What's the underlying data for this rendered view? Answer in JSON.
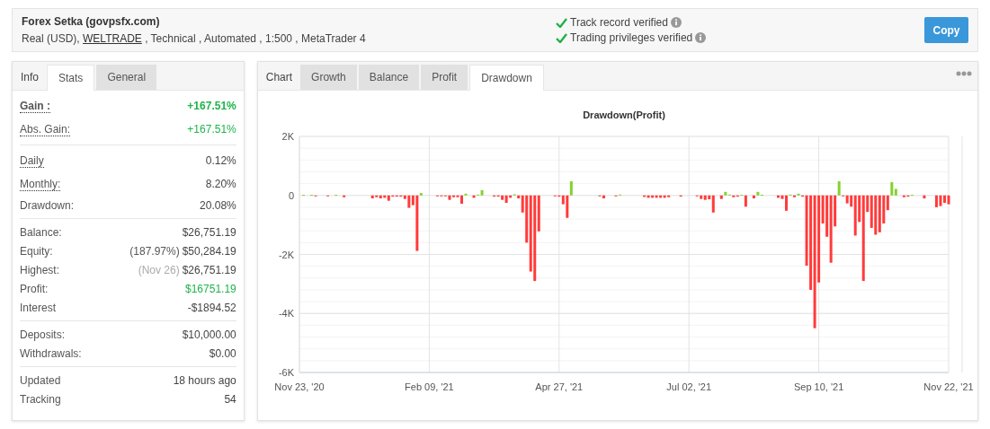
{
  "header": {
    "title": "Forex Setka (govpsfx.com)",
    "details_prefix": "Real (USD), ",
    "broker_link": "WELTRADE",
    "details_suffix": " , Technical , Automated , 1:500 , MetaTrader 4",
    "verifications": [
      {
        "label": "Track record verified",
        "verified": true
      },
      {
        "label": "Trading privileges verified",
        "verified": true
      }
    ],
    "copy_button": "Copy"
  },
  "stats_panel": {
    "title": "Info",
    "tabs": [
      {
        "label": "Stats",
        "selected": true
      },
      {
        "label": "General",
        "selected": false
      }
    ],
    "groups": [
      [
        {
          "label": "Gain :",
          "value": "+167.51%",
          "tooltip": true,
          "bold": true,
          "positive": true
        },
        {
          "label": "Abs. Gain:",
          "value": "+167.51%",
          "tooltip": true,
          "bold": false,
          "positive": true
        }
      ],
      [
        {
          "label": "Daily",
          "value": "0.12%",
          "tooltip": true,
          "bold": false,
          "positive": false
        },
        {
          "label": "Monthly:",
          "value": "8.20%",
          "tooltip": true,
          "bold": false,
          "positive": false
        },
        {
          "label": "Drawdown:",
          "value": "20.08%",
          "tooltip": false,
          "bold": false,
          "positive": false
        }
      ],
      [
        {
          "label": "Balance:",
          "value": "$26,751.19",
          "tooltip": false,
          "bold": false,
          "positive": false
        },
        {
          "label": "Equity:",
          "note": "(187.97%)",
          "note_muted": false,
          "value": "$50,284.19",
          "tooltip": false,
          "bold": false,
          "positive": false
        },
        {
          "label": "Highest:",
          "note": "(Nov 26)",
          "note_muted": true,
          "value": "$26,751.19",
          "tooltip": false,
          "bold": false,
          "positive": false
        },
        {
          "label": "Profit:",
          "value": "$16751.19",
          "tooltip": false,
          "bold": false,
          "positive": true
        },
        {
          "label": "Interest",
          "value": "-$1894.52",
          "tooltip": false,
          "bold": false,
          "positive": false
        }
      ],
      [
        {
          "label": "Deposits:",
          "value": "$10,000.00",
          "tooltip": false,
          "bold": false,
          "positive": false
        },
        {
          "label": "Withdrawals:",
          "value": "$0.00",
          "tooltip": false,
          "bold": false,
          "positive": false
        }
      ],
      [
        {
          "label": "Updated",
          "value": "18 hours ago",
          "tooltip": false,
          "bold": false,
          "positive": false
        },
        {
          "label": "Tracking",
          "value": "54",
          "tooltip": false,
          "bold": false,
          "positive": false
        }
      ]
    ]
  },
  "chart_panel": {
    "title": "Chart",
    "tabs": [
      {
        "label": "Growth",
        "selected": false
      },
      {
        "label": "Balance",
        "selected": false
      },
      {
        "label": "Profit",
        "selected": false
      },
      {
        "label": "Drawdown",
        "selected": true
      }
    ],
    "chart_data": {
      "type": "bar",
      "title": "Drawdown(Profit)",
      "grid": true,
      "ylim": [
        -6000,
        2000
      ],
      "categories": [
        "Nov 23, '20",
        null,
        null,
        null,
        null,
        null,
        null,
        null,
        null,
        null,
        null,
        null,
        null,
        null,
        null,
        null,
        null,
        null,
        null,
        null,
        null,
        null,
        null,
        null,
        null,
        null,
        null,
        null,
        null,
        null,
        null,
        null,
        "Feb 09, '21",
        null,
        null,
        null,
        null,
        null,
        null,
        null,
        null,
        null,
        null,
        null,
        null,
        null,
        null,
        null,
        null,
        null,
        null,
        null,
        null,
        null,
        null,
        null,
        null,
        null,
        null,
        null,
        null,
        null,
        null,
        null,
        "Apr 27, '21",
        null,
        null,
        null,
        null,
        null,
        null,
        null,
        null,
        null,
        null,
        null,
        null,
        null,
        null,
        null,
        null,
        null,
        null,
        null,
        null,
        null,
        null,
        null,
        null,
        null,
        null,
        null,
        null,
        null,
        null,
        null,
        "Jul 02, '21",
        null,
        null,
        null,
        null,
        null,
        null,
        null,
        null,
        null,
        null,
        null,
        null,
        null,
        null,
        null,
        null,
        null,
        null,
        null,
        null,
        null,
        null,
        null,
        null,
        null,
        null,
        null,
        null,
        null,
        null,
        null,
        "Sep 10, '21",
        null,
        null,
        null,
        null,
        null,
        null,
        null,
        null,
        null,
        null,
        null,
        null,
        null,
        null,
        null,
        null,
        null,
        null,
        null,
        null,
        null,
        null,
        null,
        null,
        null,
        null,
        null,
        null,
        null,
        null,
        null,
        "Nov 22, '21"
      ],
      "yticks": [
        {
          "value": 2000,
          "label": "2K"
        },
        {
          "value": 0,
          "label": "0"
        },
        {
          "value": -2000,
          "label": "-2K"
        },
        {
          "value": -4000,
          "label": "-4K"
        },
        {
          "value": -6000,
          "label": "-6K"
        }
      ],
      "series": [
        {
          "color": "#ff3b3b",
          "values": [
            null,
            null,
            null,
            null,
            -20,
            null,
            null,
            -20,
            null,
            null,
            null,
            -60,
            null,
            null,
            null,
            null,
            null,
            null,
            -100,
            -60,
            -100,
            -80,
            -180,
            -40,
            -40,
            -40,
            -120,
            -420,
            -330,
            -1880,
            null,
            null,
            null,
            null,
            -30,
            -30,
            -30,
            -150,
            -60,
            -60,
            -280,
            null,
            null,
            -80,
            null,
            null,
            null,
            null,
            -40,
            -40,
            -150,
            -250,
            -80,
            null,
            -100,
            -580,
            -1600,
            -2580,
            -2900,
            -1220,
            null,
            null,
            null,
            -30,
            -40,
            -300,
            -760,
            null,
            null,
            null,
            null,
            null,
            null,
            null,
            -30,
            -100,
            null,
            null,
            -30,
            null,
            null,
            null,
            null,
            null,
            null,
            -50,
            -80,
            -80,
            -80,
            -80,
            -80,
            -60,
            null,
            null,
            -40,
            null,
            null,
            null,
            -30,
            -120,
            -150,
            -130,
            -580,
            null,
            -120,
            null,
            null,
            -60,
            -40,
            null,
            -380,
            null,
            -100,
            null,
            null,
            null,
            null,
            null,
            -80,
            -120,
            -520,
            null,
            -60,
            null,
            -40,
            -2380,
            -3200,
            -4500,
            -2950,
            -950,
            -1400,
            -2280,
            -1050,
            null,
            -30,
            -270,
            -380,
            -1360,
            -900,
            -2900,
            -560,
            -1100,
            -1330,
            -1250,
            -950,
            -500,
            null,
            null,
            null,
            -60,
            -40,
            null,
            null,
            null,
            -100,
            null,
            null,
            -400,
            -360,
            -250,
            -300
          ]
        },
        {
          "color": "#86d12f",
          "values": [
            null,
            20,
            null,
            20,
            null,
            null,
            null,
            null,
            null,
            20,
            null,
            null,
            null,
            null,
            null,
            null,
            null,
            null,
            null,
            null,
            null,
            null,
            null,
            null,
            null,
            null,
            null,
            null,
            null,
            null,
            80,
            null,
            null,
            null,
            null,
            null,
            null,
            null,
            null,
            null,
            null,
            60,
            null,
            null,
            30,
            180,
            null,
            null,
            null,
            null,
            null,
            null,
            null,
            40,
            null,
            null,
            null,
            null,
            null,
            null,
            null,
            null,
            null,
            null,
            null,
            null,
            null,
            480,
            null,
            null,
            null,
            null,
            null,
            null,
            null,
            null,
            null,
            null,
            null,
            30,
            null,
            null,
            null,
            null,
            null,
            null,
            null,
            null,
            null,
            null,
            null,
            null,
            null,
            null,
            null,
            null,
            null,
            null,
            null,
            null,
            null,
            null,
            null,
            null,
            null,
            120,
            30,
            null,
            null,
            20,
            null,
            null,
            null,
            120,
            20,
            null,
            null,
            null,
            null,
            null,
            null,
            30,
            null,
            60,
            null,
            null,
            null,
            null,
            null,
            null,
            null,
            null,
            null,
            480,
            null,
            null,
            null,
            null,
            null,
            null,
            null,
            null,
            null,
            null,
            null,
            null,
            450,
            220,
            null,
            null,
            null,
            20,
            null,
            null,
            null,
            null,
            null,
            null,
            null,
            null,
            null
          ]
        }
      ]
    }
  }
}
